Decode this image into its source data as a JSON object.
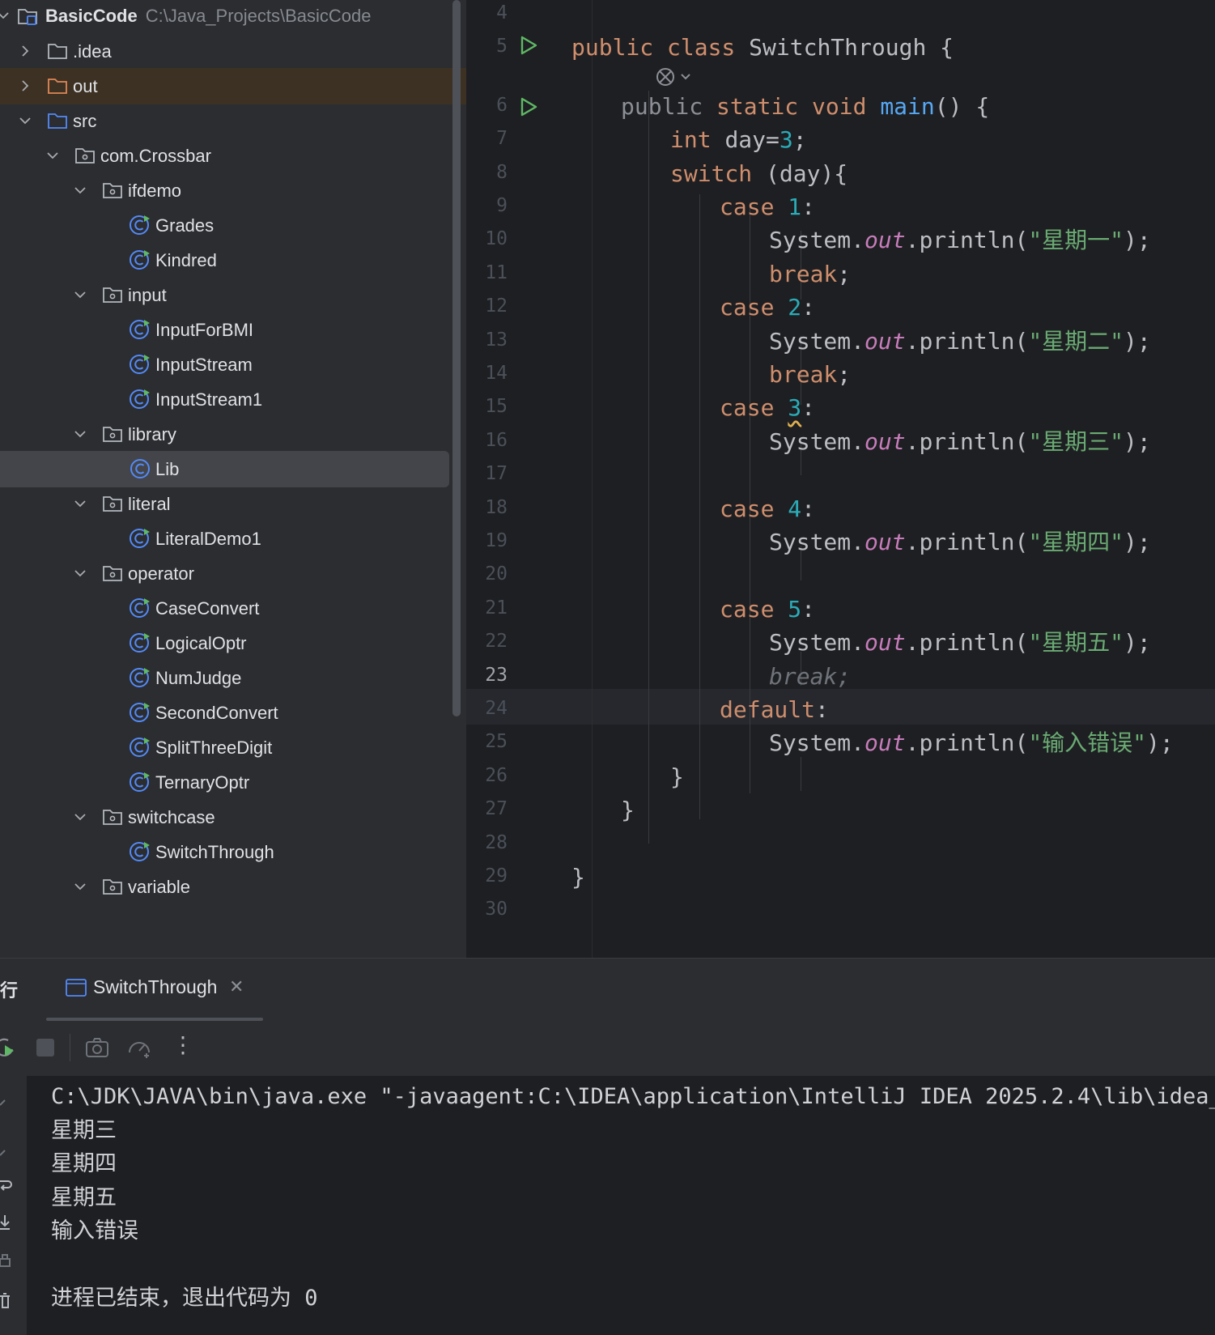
{
  "project_tree": {
    "root": {
      "name": "BasicCode",
      "path": "C:\\Java_Projects\\BasicCode"
    },
    "items": [
      {
        "label": ".idea",
        "kind": "folder"
      },
      {
        "label": "out",
        "kind": "folder-excluded"
      },
      {
        "label": "src",
        "kind": "source-folder"
      },
      {
        "label": "com.Crossbar",
        "kind": "package"
      },
      {
        "label": "ifdemo",
        "kind": "package"
      },
      {
        "label": "Grades",
        "kind": "class-runnable"
      },
      {
        "label": "Kindred",
        "kind": "class-runnable"
      },
      {
        "label": "input",
        "kind": "package"
      },
      {
        "label": "InputForBMI",
        "kind": "class-runnable"
      },
      {
        "label": "InputStream",
        "kind": "class-runnable"
      },
      {
        "label": "InputStream1",
        "kind": "class-runnable"
      },
      {
        "label": "library",
        "kind": "package"
      },
      {
        "label": "Lib",
        "kind": "class",
        "selected": true
      },
      {
        "label": "literal",
        "kind": "package"
      },
      {
        "label": "LiteralDemo1",
        "kind": "class-runnable"
      },
      {
        "label": "operator",
        "kind": "package"
      },
      {
        "label": "CaseConvert",
        "kind": "class-runnable"
      },
      {
        "label": "LogicalOptr",
        "kind": "class-runnable"
      },
      {
        "label": "NumJudge",
        "kind": "class-runnable"
      },
      {
        "label": "SecondConvert",
        "kind": "class-runnable"
      },
      {
        "label": "SplitThreeDigit",
        "kind": "class-runnable"
      },
      {
        "label": "TernaryOptr",
        "kind": "class-runnable"
      },
      {
        "label": "switchcase",
        "kind": "package"
      },
      {
        "label": "SwitchThrough",
        "kind": "class-runnable"
      },
      {
        "label": "variable",
        "kind": "package"
      }
    ]
  },
  "editor": {
    "current_line": "23",
    "line_numbers": [
      "4",
      "5",
      "6",
      "7",
      "8",
      "9",
      "10",
      "11",
      "12",
      "13",
      "14",
      "15",
      "16",
      "17",
      "18",
      "19",
      "20",
      "21",
      "22",
      "23",
      "24",
      "25",
      "26",
      "27",
      "28",
      "29",
      "30"
    ],
    "lines": [
      [],
      [
        {
          "t": "public class ",
          "c": "kw"
        },
        {
          "t": "SwitchThrough {",
          "c": "plain"
        }
      ],
      [
        {
          "t": "public ",
          "c": "dimkw"
        },
        {
          "t": "static void ",
          "c": "kw"
        },
        {
          "t": "main",
          "c": "fn"
        },
        {
          "t": "() {",
          "c": "plain"
        }
      ],
      [
        {
          "t": "int ",
          "c": "kw"
        },
        {
          "t": "day=",
          "c": "plain"
        },
        {
          "t": "3",
          "c": "num"
        },
        {
          "t": ";",
          "c": "plain"
        }
      ],
      [
        {
          "t": "switch ",
          "c": "kw"
        },
        {
          "t": "(day){",
          "c": "plain"
        }
      ],
      [
        {
          "t": "case ",
          "c": "kw"
        },
        {
          "t": "1",
          "c": "num"
        },
        {
          "t": ":",
          "c": "plain"
        }
      ],
      [
        {
          "t": "System.",
          "c": "plain"
        },
        {
          "t": "out",
          "c": "fld"
        },
        {
          "t": ".println(",
          "c": "plain"
        },
        {
          "t": "\"星期一\"",
          "c": "str"
        },
        {
          "t": ");",
          "c": "plain"
        }
      ],
      [
        {
          "t": "break",
          "c": "kw"
        },
        {
          "t": ";",
          "c": "plain"
        }
      ],
      [
        {
          "t": "case ",
          "c": "kw"
        },
        {
          "t": "2",
          "c": "num"
        },
        {
          "t": ":",
          "c": "plain"
        }
      ],
      [
        {
          "t": "System.",
          "c": "plain"
        },
        {
          "t": "out",
          "c": "fld"
        },
        {
          "t": ".println(",
          "c": "plain"
        },
        {
          "t": "\"星期二\"",
          "c": "str"
        },
        {
          "t": ");",
          "c": "plain"
        }
      ],
      [
        {
          "t": "break",
          "c": "kw"
        },
        {
          "t": ";",
          "c": "plain"
        }
      ],
      [
        {
          "t": "case ",
          "c": "kw"
        },
        {
          "t": "3",
          "c": "num squiggle"
        },
        {
          "t": ":",
          "c": "plain"
        }
      ],
      [
        {
          "t": "System.",
          "c": "plain"
        },
        {
          "t": "out",
          "c": "fld"
        },
        {
          "t": ".println(",
          "c": "plain"
        },
        {
          "t": "\"星期三\"",
          "c": "str"
        },
        {
          "t": ");",
          "c": "plain"
        }
      ],
      [],
      [
        {
          "t": "case ",
          "c": "kw"
        },
        {
          "t": "4",
          "c": "num"
        },
        {
          "t": ":",
          "c": "plain"
        }
      ],
      [
        {
          "t": "System.",
          "c": "plain"
        },
        {
          "t": "out",
          "c": "fld"
        },
        {
          "t": ".println(",
          "c": "plain"
        },
        {
          "t": "\"星期四\"",
          "c": "str"
        },
        {
          "t": ");",
          "c": "plain"
        }
      ],
      [],
      [
        {
          "t": "case ",
          "c": "kw"
        },
        {
          "t": "5",
          "c": "num"
        },
        {
          "t": ":",
          "c": "plain"
        }
      ],
      [
        {
          "t": "System.",
          "c": "plain"
        },
        {
          "t": "out",
          "c": "fld"
        },
        {
          "t": ".println(",
          "c": "plain"
        },
        {
          "t": "\"星期五\"",
          "c": "str"
        },
        {
          "t": ");",
          "c": "plain"
        }
      ],
      [
        {
          "t": "break;",
          "c": "dim"
        }
      ],
      [
        {
          "t": "default",
          "c": "kw"
        },
        {
          "t": ":",
          "c": "plain"
        }
      ],
      [
        {
          "t": "System.",
          "c": "plain"
        },
        {
          "t": "out",
          "c": "fld"
        },
        {
          "t": ".println(",
          "c": "plain"
        },
        {
          "t": "\"输入错误\"",
          "c": "str"
        },
        {
          "t": ");",
          "c": "plain"
        }
      ],
      [
        {
          "t": "}",
          "c": "plain"
        }
      ],
      [
        {
          "t": "}",
          "c": "plain"
        }
      ],
      [],
      [
        {
          "t": "}",
          "c": "plain"
        }
      ],
      []
    ]
  },
  "run_panel": {
    "title": "运行",
    "tab_label": "SwitchThrough",
    "close_glyph": "✕",
    "toolbar": {
      "rerun": "rerun-icon",
      "stop": "stop-icon",
      "screenshot": "camera-icon",
      "profiler": "gauge-icon",
      "more": "⋮"
    },
    "console_lines": [
      "C:\\JDK\\JAVA\\bin\\java.exe \"-javaagent:C:\\IDEA\\application\\IntelliJ IDEA 2025.2.4\\lib\\idea_r",
      "星期三",
      "星期四",
      "星期五",
      "输入错误",
      "",
      "进程已结束，退出代码为 0"
    ]
  },
  "colors": {
    "keyword": "#cf8e6d",
    "number": "#2aacb8",
    "string": "#6aab73",
    "static_field": "#c77dbb",
    "method": "#56a8f5",
    "text": "#bcbec4",
    "run_arrow": "#5fb865"
  }
}
